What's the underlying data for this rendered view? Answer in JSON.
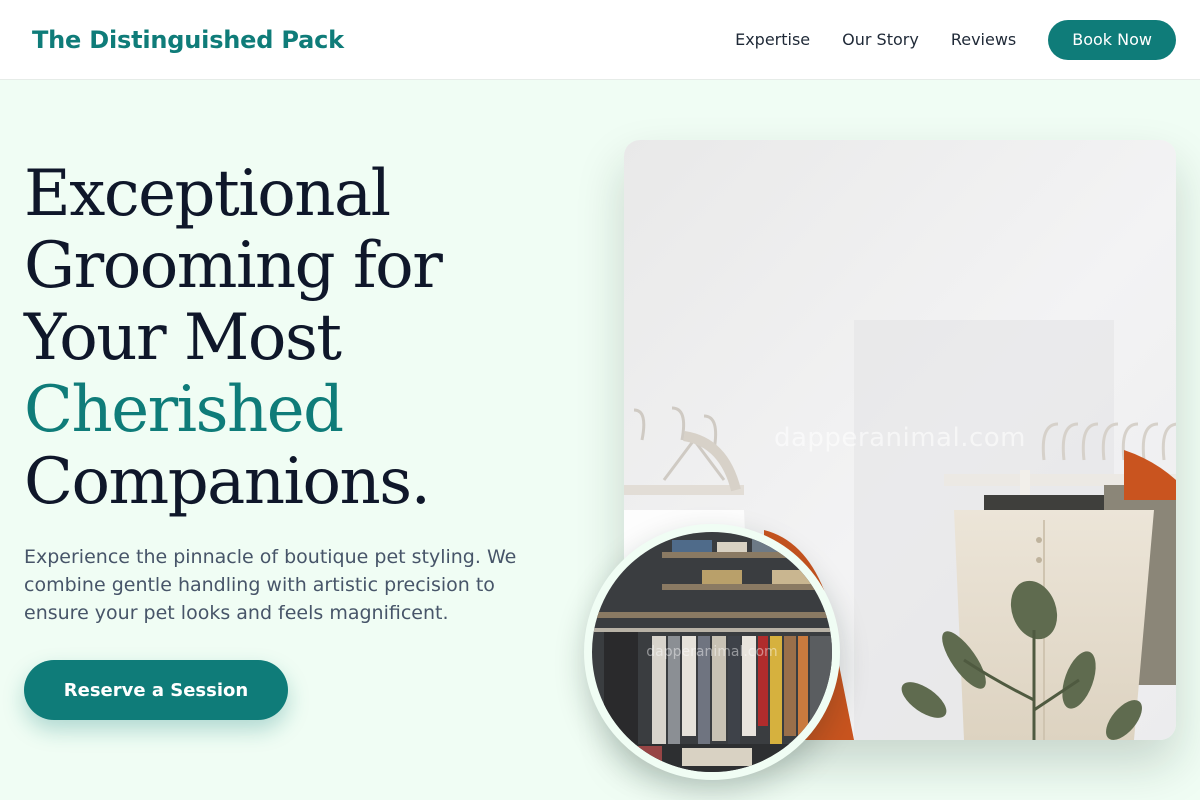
{
  "brand": {
    "name": "The Distinguished Pack",
    "accent_color": "#0f7c79"
  },
  "nav": {
    "links": [
      "Expertise",
      "Our Story",
      "Reviews"
    ],
    "cta": "Book Now"
  },
  "hero": {
    "title_lines": [
      "Exceptional",
      "Grooming for",
      "Your Most",
      "Cherished",
      "Companions."
    ],
    "accent_line_index": 3,
    "description": "Experience the pinnacle of boutique pet styling. We combine gentle handling with artistic precision to ensure your pet looks and feels magnificent.",
    "cta": "Reserve a Session"
  },
  "images": {
    "main": {
      "subject": "clothing-rack-photo",
      "watermark": "dapperanimal.com"
    },
    "inset": {
      "subject": "wardrobe-closet-photo",
      "watermark": "dapperanimal.com"
    }
  },
  "colors": {
    "background": "#f0fdf4",
    "heading": "#0f172a",
    "body_text": "#475569"
  }
}
